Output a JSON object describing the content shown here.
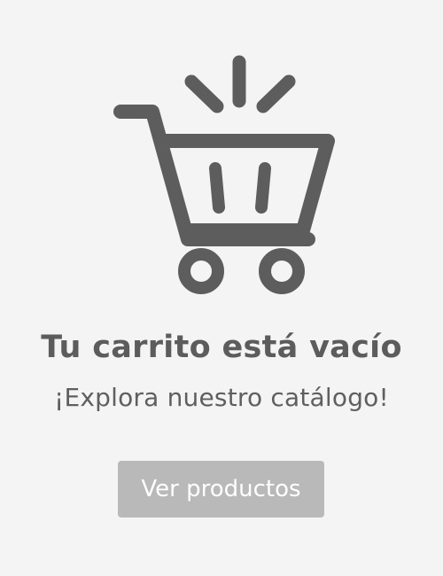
{
  "empty_cart": {
    "icon": "shopping-cart-icon",
    "title": "Tu carrito está vacío",
    "subtitle": "¡Explora nuestro catálogo!",
    "button_label": "Ver productos"
  },
  "colors": {
    "background": "#f4f4f4",
    "icon": "#5d5d5d",
    "text": "#5c5c5c",
    "button_bg": "#b9b9b9",
    "button_text": "#ffffff"
  }
}
